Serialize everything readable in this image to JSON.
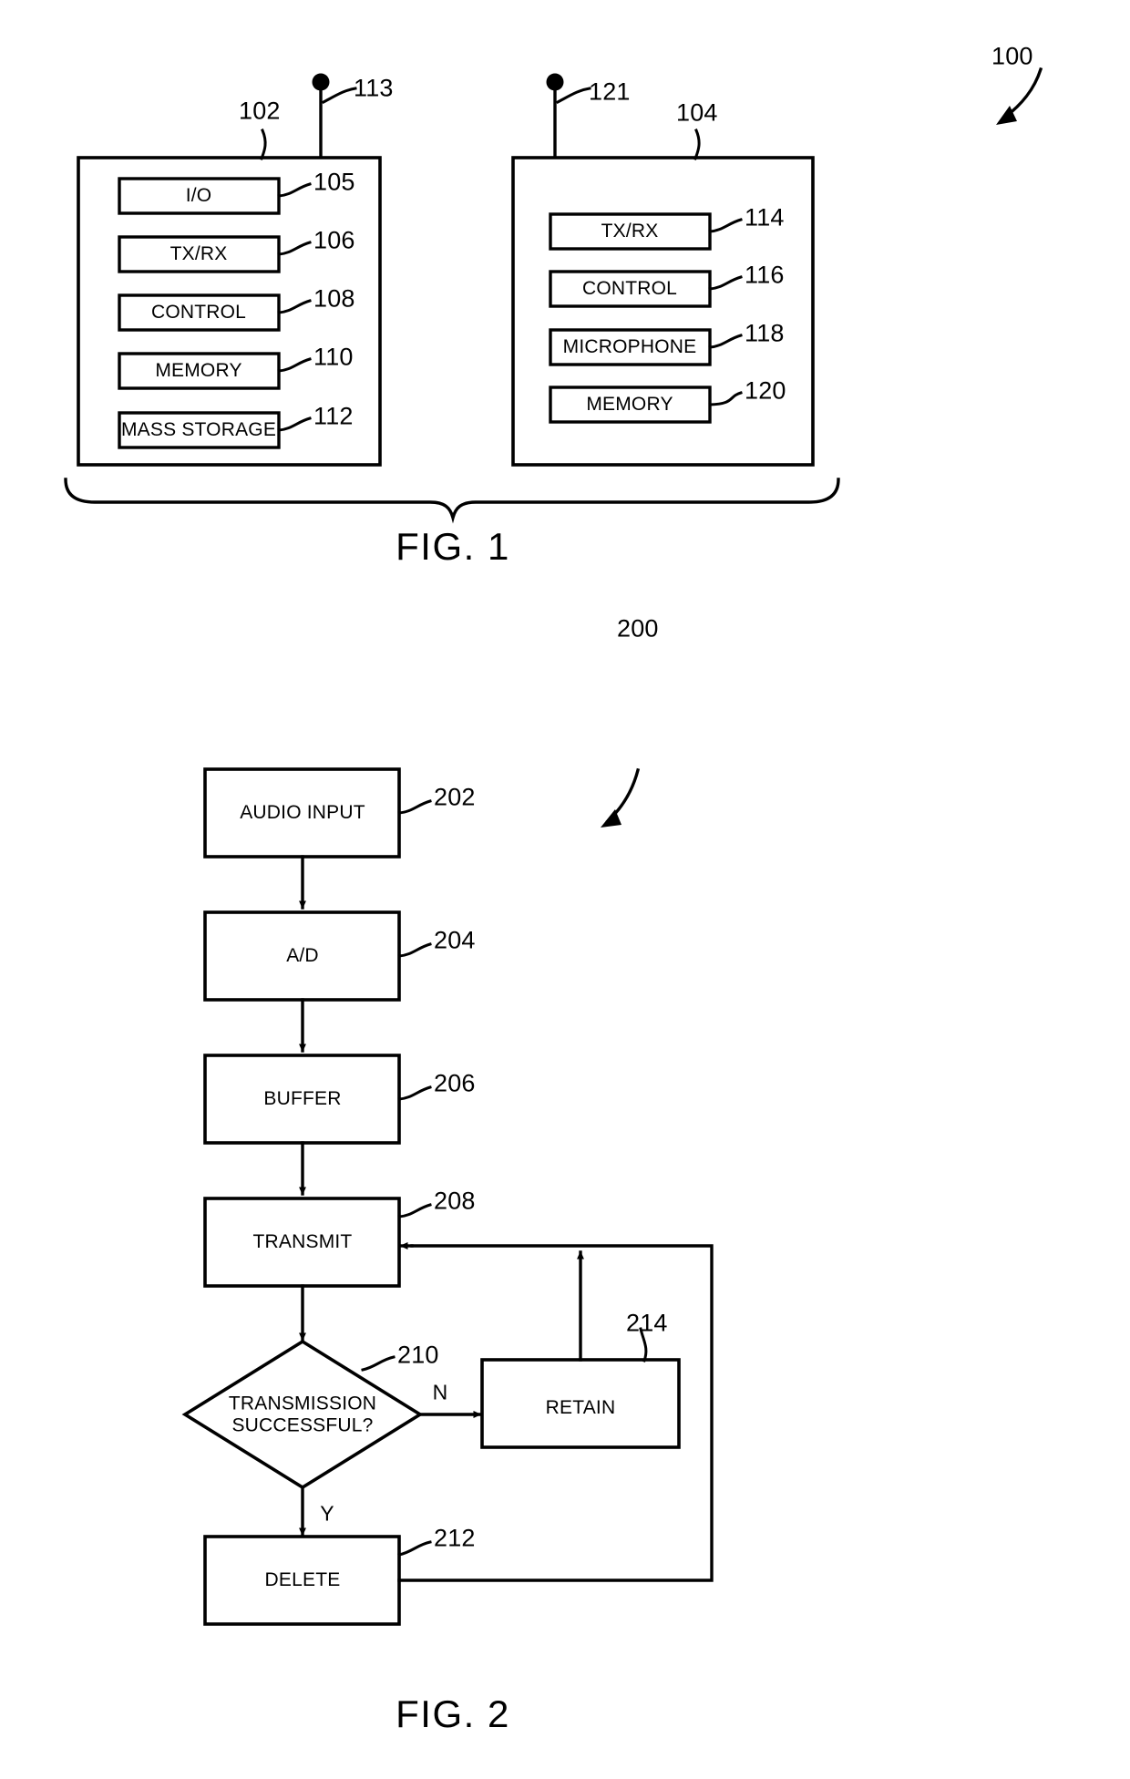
{
  "document": {
    "type": "patent-drawing-sheet",
    "background": "#ffffff",
    "ink": "#000000"
  },
  "figures": [
    {
      "id": "fig1",
      "caption": "FIG. 1",
      "system_ref": "100",
      "devices": [
        {
          "ref": "102",
          "antenna_ref": "113",
          "modules": [
            {
              "label": "I/O",
              "ref": "105"
            },
            {
              "label": "TX/RX",
              "ref": "106"
            },
            {
              "label": "CONTROL",
              "ref": "108"
            },
            {
              "label": "MEMORY",
              "ref": "110"
            },
            {
              "label": "MASS STORAGE",
              "ref": "112"
            }
          ]
        },
        {
          "ref": "104",
          "antenna_ref": "121",
          "modules": [
            {
              "label": "TX/RX",
              "ref": "114"
            },
            {
              "label": "CONTROL",
              "ref": "116"
            },
            {
              "label": "MICROPHONE",
              "ref": "118"
            },
            {
              "label": "MEMORY",
              "ref": "120"
            }
          ]
        }
      ]
    },
    {
      "id": "fig2",
      "caption": "FIG. 2",
      "process_ref": "200",
      "steps": [
        {
          "label": "AUDIO INPUT",
          "ref": "202",
          "shape": "process"
        },
        {
          "label": "A/D",
          "ref": "204",
          "shape": "process"
        },
        {
          "label": "BUFFER",
          "ref": "206",
          "shape": "process"
        },
        {
          "label": "TRANSMIT",
          "ref": "208",
          "shape": "process"
        },
        {
          "label": "TRANSMISSION SUCCESSFUL?",
          "label_line1": "TRANSMISSION",
          "label_line2": "SUCCESSFUL?",
          "ref": "210",
          "shape": "decision"
        },
        {
          "label": "DELETE",
          "ref": "212",
          "shape": "process"
        },
        {
          "label": "RETAIN",
          "ref": "214",
          "shape": "process"
        }
      ],
      "branch_labels": {
        "no": "N",
        "yes": "Y"
      }
    }
  ]
}
